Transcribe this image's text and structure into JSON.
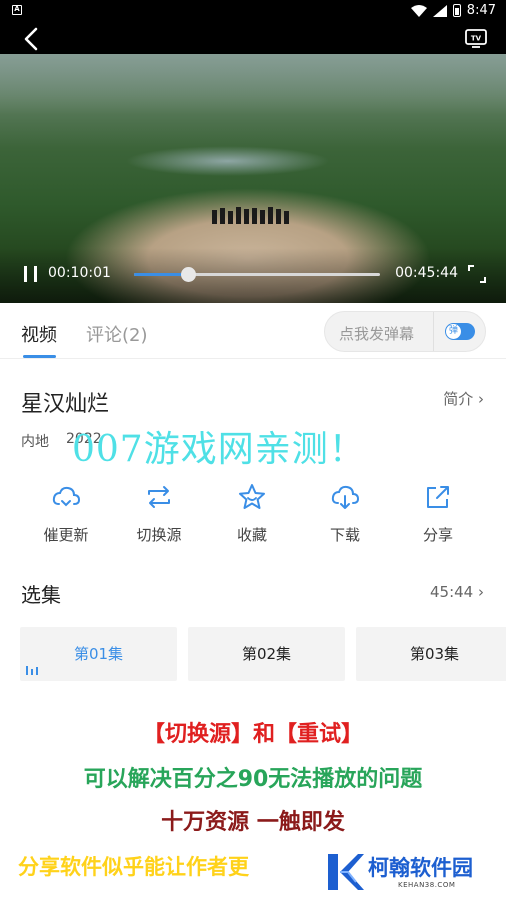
{
  "status_bar": {
    "time": "8:47",
    "left_badge": "A"
  },
  "player": {
    "current_time": "00:10:01",
    "total_time": "00:45:44",
    "progress": 0.22
  },
  "tabs": [
    {
      "label": "视频",
      "active": true
    },
    {
      "label": "评论(2)",
      "active": false
    }
  ],
  "danmu": {
    "placeholder": "点我发弹幕",
    "toggle_label": "弹",
    "enabled": true
  },
  "show": {
    "title": "星汉灿烂",
    "intro_label": "简介 ›",
    "region": "内地",
    "year": "2022"
  },
  "watermark_top": "007游戏网亲测！",
  "actions": [
    {
      "label": "催更新",
      "icon": "cloud-refresh-icon"
    },
    {
      "label": "切换源",
      "icon": "switch-source-icon"
    },
    {
      "label": "收藏",
      "icon": "star-icon"
    },
    {
      "label": "下载",
      "icon": "cloud-download-icon"
    },
    {
      "label": "分享",
      "icon": "share-icon"
    }
  ],
  "episodes": {
    "heading": "选集",
    "duration_label": "45:44 ›",
    "items": [
      {
        "label": "第01集",
        "active": true
      },
      {
        "label": "第02集",
        "active": false
      },
      {
        "label": "第03集",
        "active": false
      }
    ]
  },
  "promo": {
    "line1": "【切换源】和【重试】",
    "line2": "可以解决百分之90无法播放的问题",
    "line3": "十万资源  一触即发",
    "line4": "分享软件似乎能让作者更"
  },
  "site_logo": {
    "name": "柯翰软件园",
    "url": "KEHAN38.COM"
  },
  "colors": {
    "accent": "#3a8ee6",
    "promo_red": "#e02020",
    "promo_green": "#28a55a",
    "promo_dark_red": "#8b1a1a",
    "promo_yellow": "#ffd21a",
    "watermark_cyan": "#4fe0e6"
  }
}
